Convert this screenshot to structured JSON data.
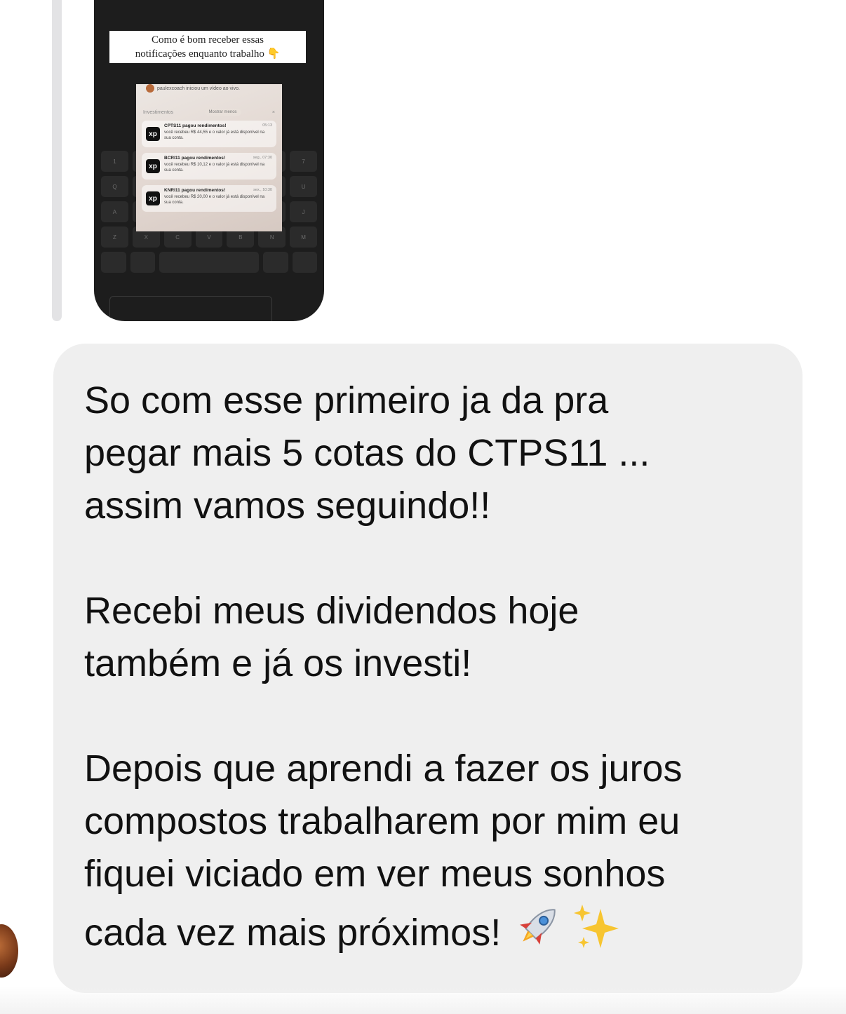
{
  "story_preview": {
    "caption_line1": "Como é bom receber essas",
    "caption_line2": "notificações enquanto trabalho 👇",
    "live_notice": "paulexcoach iniciou um vídeo ao vivo.",
    "group_label": "Investimentos",
    "show_less": "Mostrar menos",
    "notifications": [
      {
        "title": "CPTS11 pagou rendimentos!",
        "body": "você recebeu R$ 44,55 e o valor já está disponível na sua conta.",
        "time": "05:13",
        "logo": "xp"
      },
      {
        "title": "BCRI11 pagou rendimentos!",
        "body": "você recebeu R$ 10,12 e o valor já está disponível na sua conta.",
        "time": "seg., 07:30",
        "logo": "xp"
      },
      {
        "title": "KNRI11 pagou rendimentos!",
        "body": "você recebeu R$ 20,00 e o valor já está disponível na sua conta.",
        "time": "sex., 10:30",
        "logo": "xp"
      }
    ]
  },
  "message": {
    "paragraph1": "So com esse primeiro ja da pra\npegar mais 5 cotas do CTPS11 ...\nassim vamos seguindo!!",
    "paragraph2": "Recebi meus dividendos hoje\ntambém e já os investi!",
    "paragraph3": "Depois que aprendi a fazer os juros\ncompostos trabalharem por mim eu\nfiquei viciado em ver meus sonhos\ncada vez mais próximos!",
    "emoji_icons": [
      "rocket-icon",
      "sparkles-icon"
    ]
  },
  "colors": {
    "bubble": "#efefef",
    "text": "#111111",
    "reply_bar": "#e3e3e5",
    "story_bg": "#1d1d1d"
  }
}
